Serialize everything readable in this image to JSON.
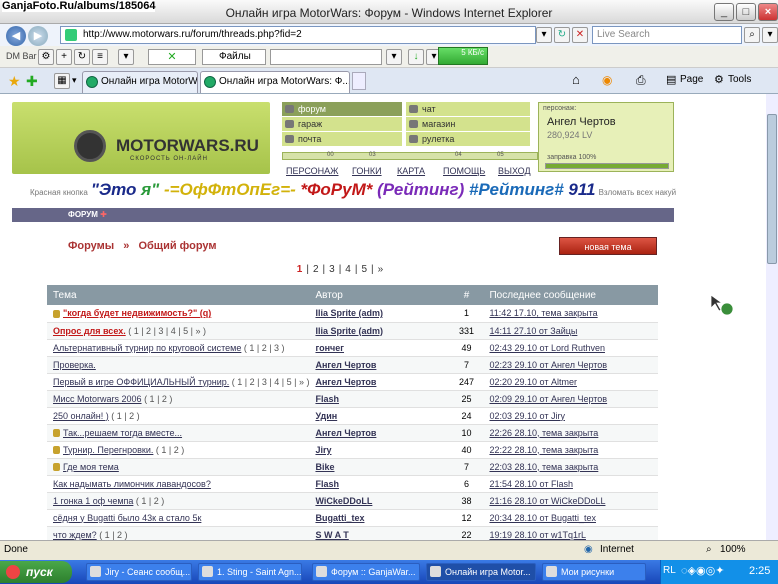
{
  "window": {
    "watermark": "GanjaFoto.Ru/albums/185064",
    "title": "Онлайн игра MotorWars: Форум - Windows Internet Explorer"
  },
  "address": {
    "url": "http://www.motorwars.ru/forum/threads.php?fid=2",
    "search_placeholder": "Live Search"
  },
  "toolbar2": {
    "dmbar": "DM Bar",
    "files_select": "Файлы",
    "size_label": "5 КБ/с"
  },
  "tabs": [
    {
      "label": "Онлайн игра MotorWars..."
    },
    {
      "label": "Онлайн игра MotorWars: Ф..."
    }
  ],
  "ie_tools": {
    "page": "Page",
    "tools": "Tools"
  },
  "site": {
    "logo": "MOTORWARS.RU",
    "logo_sub": "СКОРОСТЬ ОН-ЛАЙН",
    "menu": [
      {
        "label": "форум",
        "icon": "forum-icon",
        "selected": true
      },
      {
        "label": "гараж",
        "icon": "wrench-icon",
        "selected": false
      },
      {
        "label": "почта",
        "icon": "mail-icon",
        "selected": false
      },
      {
        "label": "чат",
        "icon": "chat-icon",
        "selected": false
      },
      {
        "label": "магазин",
        "icon": "car-icon",
        "selected": false
      },
      {
        "label": "рулетка",
        "icon": "roulette-icon",
        "selected": false
      }
    ],
    "progress_marks": [
      "00",
      "03",
      "04",
      "05"
    ],
    "nav": [
      "ПЕРСОНАЖ",
      "ГОНКИ",
      "КАРТА",
      "ПОМОЩЬ",
      "ВЫХОД"
    ],
    "profile": {
      "header": "персонаж:",
      "name": "Ангел Чертов",
      "balance": "280,924 LV",
      "refuel_label": "заправка 100%",
      "refuel": 1.0
    },
    "promo": {
      "left": "Красная кнопка",
      "big": "\"Это я\" -=ОфФтОпЕг=- *ФоРуМ* (Рейтинг) #Рейтинг# 911",
      "right": "Взломать всех накуй"
    },
    "section_label": "ФОРУМ",
    "breadcrumb": {
      "root": "Форумы",
      "sep": "»",
      "current": "Общий форум"
    },
    "new_topic": "новая тема",
    "pagination": [
      "1",
      "|",
      "2",
      "|",
      "3",
      "|",
      "4",
      "|",
      "5",
      "|",
      "»"
    ]
  },
  "table": {
    "headers": [
      "Тема",
      "Автор",
      "#",
      "Последнее сообщение"
    ],
    "rows": [
      {
        "topic": "\"когда будет недвижимость?\" (q)",
        "topic_extra": "",
        "author": "Ilia Sprite (adm)",
        "count": "1",
        "last": "11:42 17.10, тема закрыта",
        "red": true,
        "locked": true
      },
      {
        "topic": "Опрос для всех.",
        "topic_extra": " ( 1 | 2 | 3 | 4 | 5 | » )",
        "author": "Ilia Sprite (adm)",
        "count": "331",
        "last": "14:11 27.10 от Зайцы",
        "red": true,
        "locked": false
      },
      {
        "topic": "Альтернативный турнир по круговой системе",
        "topic_extra": " ( 1 | 2 | 3 )",
        "author": "гончег",
        "count": "49",
        "last": "02:43 29.10 от Lord Ruthven",
        "red": false,
        "locked": false
      },
      {
        "topic": "Проверка.",
        "topic_extra": "",
        "author": "Ангел Чертов",
        "count": "7",
        "last": "02:23 29.10 от Ангел Чертов",
        "red": false,
        "locked": false
      },
      {
        "topic": "Первый в игре ОФФИЦИАЛЬНЫЙ турнир.",
        "topic_extra": " ( 1 | 2 | 3 | 4 | 5 | » )",
        "author": "Ангел Чертов",
        "count": "247",
        "last": "02:20 29.10 от Altmer",
        "red": false,
        "locked": false
      },
      {
        "topic": "Мисс Motorwars 2006",
        "topic_extra": " ( 1 | 2 )",
        "author": "Flash",
        "count": "25",
        "last": "02:09 29.10 от Ангел Чертов",
        "red": false,
        "locked": false
      },
      {
        "topic": "250 онлайн! )",
        "topic_extra": " ( 1 | 2 )",
        "author": "Удин",
        "count": "24",
        "last": "02:03 29.10 от Jiry",
        "red": false,
        "locked": false
      },
      {
        "topic": "Так...решаем тогда вместе...",
        "topic_extra": "",
        "author": "Ангел Чертов",
        "count": "10",
        "last": "22:26 28.10, тема закрыта",
        "red": false,
        "locked": true
      },
      {
        "topic": "Турнир. Перегнровки.",
        "topic_extra": " ( 1 | 2 )",
        "author": "Jiry",
        "count": "40",
        "last": "22:22 28.10, тема закрыта",
        "red": false,
        "locked": true
      },
      {
        "topic": "Где моя тема",
        "topic_extra": "",
        "author": "Bike",
        "count": "7",
        "last": "22:03 28.10, тема закрыта",
        "red": false,
        "locked": true
      },
      {
        "topic": "Как надымать лимончик лавандосов?",
        "topic_extra": "",
        "author": "Flash",
        "count": "6",
        "last": "21:54 28.10 от Flash",
        "red": false,
        "locked": false
      },
      {
        "topic": "1 гонка 1 оф чемпа",
        "topic_extra": " ( 1 | 2 )",
        "author": "WiCkeDDoLL",
        "count": "38",
        "last": "21:16 28.10 от WiCkeDDoLL",
        "red": false,
        "locked": false
      },
      {
        "topic": "сёдня у Bugatti было 43к а стало 5к",
        "topic_extra": "",
        "author": "Bugatti_tex",
        "count": "12",
        "last": "20:34 28.10 от Bugatti_tex",
        "red": false,
        "locked": false
      },
      {
        "topic": "что ждем?",
        "topic_extra": " ( 1 | 2 )",
        "author": "S W A T",
        "count": "22",
        "last": "19:19 28.10 от w1Tq1rL",
        "red": false,
        "locked": false
      }
    ]
  },
  "status": {
    "left": "Done",
    "zone": "Internet",
    "zoom": "100%"
  },
  "taskbar": {
    "start": "пуск",
    "items": [
      "Jiry - Сеанс сообщ...",
      "1. Sting - Saint Agn...",
      "Форум :: GanjaWar...",
      "Онлайн игра Motor...",
      "Мои рисунки"
    ],
    "lang": "RL",
    "clock": "2:25"
  }
}
